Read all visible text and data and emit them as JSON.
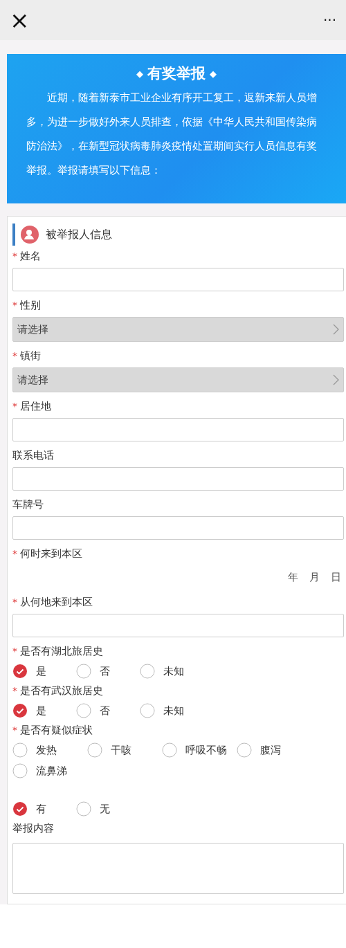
{
  "top_bar": {
    "close": "×",
    "more": "···"
  },
  "banner": {
    "ornament": "◆",
    "title": "有奖举报",
    "body": "近期，随着新泰市工业企业有序开工复工，返新来新人员增多，为进一步做好外来人员排查，依据《中华人民共和国传染病防治法》，在新型冠状病毒肺炎疫情处置期间实行人员信息有奖举报。举报请填写以下信息："
  },
  "section_title": "被举报人信息",
  "required_mark": "*",
  "fields": [
    {
      "kind": "text",
      "label": "姓名",
      "required": true
    },
    {
      "kind": "select",
      "label": "性别",
      "required": true,
      "placeholder": "请选择"
    },
    {
      "kind": "select",
      "label": "镇街",
      "required": true,
      "placeholder": "请选择"
    },
    {
      "kind": "text",
      "label": "居住地",
      "required": true
    },
    {
      "kind": "text",
      "label": "联系电话",
      "required": false
    },
    {
      "kind": "text",
      "label": "车牌号",
      "required": false
    },
    {
      "kind": "date",
      "label": "何时来到本区",
      "required": true,
      "parts": [
        "年",
        "月",
        "日"
      ]
    },
    {
      "kind": "text",
      "label": "从何地来到本区",
      "required": true
    },
    {
      "kind": "choice",
      "label": "是否有湖北旅居史",
      "required": true,
      "options": [
        {
          "label": "是",
          "selected": true
        },
        {
          "label": "否",
          "selected": false
        },
        {
          "label": "未知",
          "selected": false
        }
      ]
    },
    {
      "kind": "choice",
      "label": "是否有武汉旅居史",
      "required": true,
      "options": [
        {
          "label": "是",
          "selected": true
        },
        {
          "label": "否",
          "selected": false
        },
        {
          "label": "未知",
          "selected": false
        }
      ]
    },
    {
      "kind": "choice",
      "label": "是否有疑似症状",
      "required": true,
      "options": [
        {
          "label": "发热",
          "selected": false
        },
        {
          "label": "干咳",
          "selected": false
        },
        {
          "label": "呼吸不畅",
          "selected": false
        },
        {
          "label": "腹泻",
          "selected": false
        },
        {
          "label": "流鼻涕",
          "selected": false
        }
      ]
    },
    {
      "kind": "choice",
      "required": false,
      "options": [
        {
          "label": "有",
          "selected": true
        },
        {
          "label": "无",
          "selected": false
        }
      ]
    },
    {
      "kind": "textarea",
      "label": "举报内容",
      "required": false
    }
  ]
}
